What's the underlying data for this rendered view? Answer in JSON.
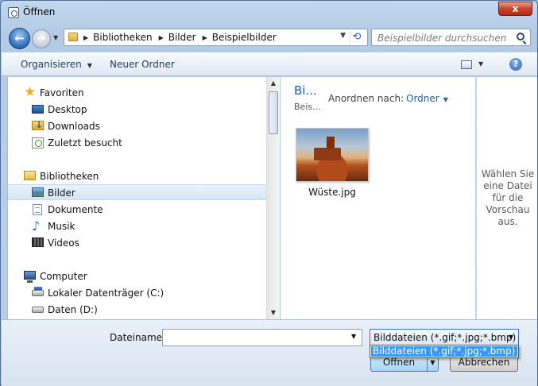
{
  "window": {
    "title": "Öffnen",
    "close_label": "x"
  },
  "address": {
    "back_glyph": "←",
    "forward_glyph": "→",
    "crumbs": [
      "Bibliotheken",
      "Bilder",
      "Beispielbilder"
    ]
  },
  "search": {
    "placeholder": "Beispielbilder durchsuchen"
  },
  "toolbar": {
    "organize_label": "Organisieren",
    "new_folder_label": "Neuer Ordner",
    "help_label": "?"
  },
  "nav": {
    "favorites": {
      "label": "Favoriten",
      "items": [
        "Desktop",
        "Downloads",
        "Zuletzt besucht"
      ]
    },
    "libraries": {
      "label": "Bibliotheken",
      "items": [
        "Bilder",
        "Dokumente",
        "Musik",
        "Videos"
      ]
    },
    "computer": {
      "label": "Computer",
      "items": [
        "Lokaler Datenträger (C:)",
        "Daten (D:)"
      ]
    },
    "selected": "Bilder"
  },
  "content": {
    "library_title": "Bi...",
    "library_subtitle": "Beis...",
    "arrange_label": "Anordnen nach:",
    "arrange_value": "Ordner",
    "files": [
      {
        "name": "Wüste.jpg"
      }
    ]
  },
  "preview": {
    "text": "Wählen Sie eine Datei für die Vorschau aus."
  },
  "bottom": {
    "filename_label": "Dateiname:",
    "filename_value": "",
    "filter_value": "Bilddateien (*.gif;*.jpg;*.bmp)",
    "filter_options": [
      "Bilddateien (*.gif;*.jpg;*.bmp)"
    ],
    "open_label": "Öffnen",
    "cancel_label": "Abbrechen"
  }
}
